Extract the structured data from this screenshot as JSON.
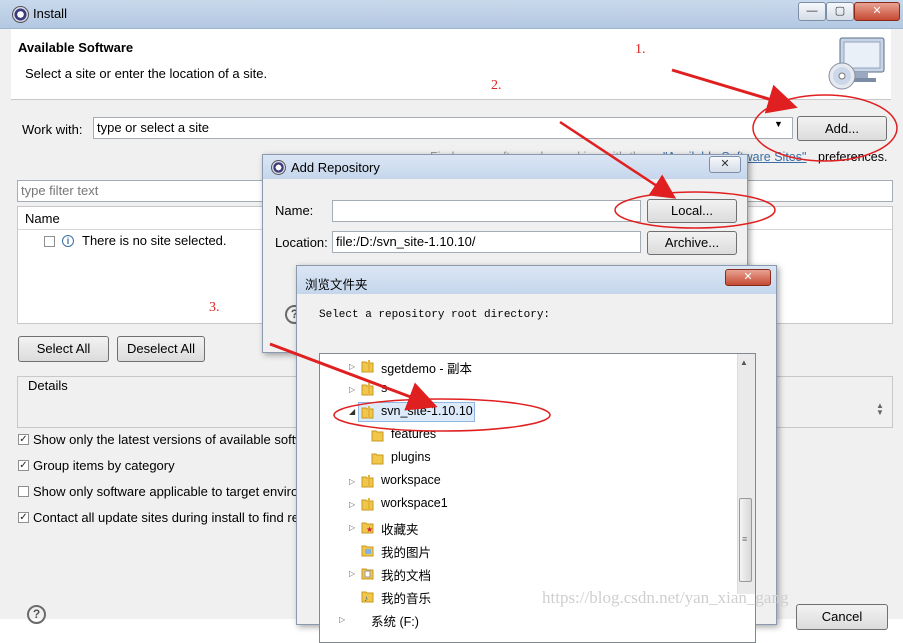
{
  "window": {
    "title": "Install"
  },
  "header": {
    "title": "Available Software",
    "subtitle": "Select a site or enter the location of a site."
  },
  "work_with": {
    "label": "Work with:",
    "placeholder": "type or select a site",
    "add_label": "Add..."
  },
  "sites_info": {
    "prefix": "Find more software by working with the",
    "link": "\"Available Software Sites\"",
    "suffix": "preferences."
  },
  "filter": {
    "placeholder": "type filter text"
  },
  "table": {
    "header_name": "Name",
    "empty_message": "There is no site selected."
  },
  "buttons": {
    "select_all": "Select All",
    "deselect_all": "Deselect All",
    "cancel": "Cancel"
  },
  "details": {
    "label": "Details"
  },
  "options": [
    {
      "label": "Show only the latest versions of available software",
      "checked": true
    },
    {
      "label": "Group items by category",
      "checked": true
    },
    {
      "label": "Show only software applicable to target environment",
      "checked": false
    },
    {
      "label": "Contact all update sites during install to find required software",
      "checked": true
    }
  ],
  "add_repo": {
    "title": "Add Repository",
    "name_label": "Name:",
    "name_value": "",
    "location_label": "Location:",
    "location_value": "file:/D:/svn_site-1.10.10/",
    "local_label": "Local...",
    "archive_label": "Archive..."
  },
  "browse": {
    "title": "浏览文件夹",
    "prompt": "Select a repository root directory:",
    "items": [
      {
        "label": "sgetdemo - 副本",
        "level": 0,
        "expander": "collapsed"
      },
      {
        "label": "s",
        "level": 0,
        "expander": "collapsed"
      },
      {
        "label": "svn_site-1.10.10",
        "level": 0,
        "expander": "expanded",
        "selected": true
      },
      {
        "label": "features",
        "level": 1,
        "expander": "none"
      },
      {
        "label": "plugins",
        "level": 1,
        "expander": "none"
      },
      {
        "label": "workspace",
        "level": 0,
        "expander": "collapsed"
      },
      {
        "label": "workspace1",
        "level": 0,
        "expander": "collapsed"
      },
      {
        "label": "收藏夹",
        "level": 0,
        "expander": "collapsed"
      },
      {
        "label": "我的图片",
        "level": 0,
        "expander": "none"
      },
      {
        "label": "我的文档",
        "level": 0,
        "expander": "collapsed"
      },
      {
        "label": "我的音乐",
        "level": 0,
        "expander": "none"
      },
      {
        "label": "系统 (F:)",
        "level": -1,
        "expander": "collapsed"
      }
    ]
  },
  "annotations": {
    "step1": "1.",
    "step2": "2.",
    "step3": "3."
  },
  "watermark": "https://blog.csdn.net/yan_xian_gang",
  "colors": {
    "annotation": "#e02020",
    "titlebar": "#c5d6ec",
    "close_button": "#c54a33"
  }
}
